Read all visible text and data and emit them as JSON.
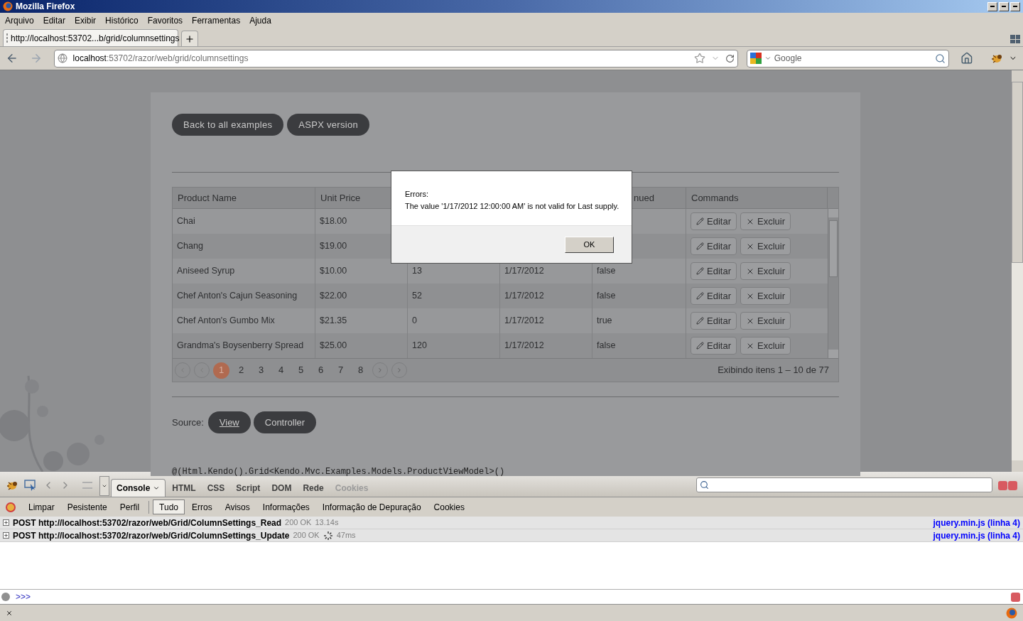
{
  "window": {
    "title": "Mozilla Firefox"
  },
  "menu": [
    "Arquivo",
    "Editar",
    "Exibir",
    "Histórico",
    "Favoritos",
    "Ferramentas",
    "Ajuda"
  ],
  "tabs": [
    {
      "label": "http://localhost:53702...b/grid/columnsettings",
      "selected": true
    }
  ],
  "address": {
    "host": "localhost",
    "path": ":53702/razor/web/grid/columnsettings"
  },
  "search": {
    "placeholder": "Google"
  },
  "page": {
    "top_buttons": [
      "Back to all examples",
      "ASPX version"
    ],
    "grid": {
      "header": {
        "product_name": "Product Name",
        "unit_price": "Unit Price",
        "column_5": "nued",
        "commands": "Commands"
      },
      "rows": [
        {
          "product_name": "Chai",
          "unit_price": "$18.00",
          "commands": [
            "Editar",
            "Excluir"
          ]
        },
        {
          "product_name": "Chang",
          "unit_price": "$19.00",
          "commands": [
            "Editar",
            "Excluir"
          ]
        },
        {
          "product_name": "Aniseed Syrup",
          "unit_price": "$10.00",
          "column_3": "13",
          "column_4": "1/17/2012",
          "column_5": "false",
          "commands": [
            "Editar",
            "Excluir"
          ]
        },
        {
          "product_name": "Chef Anton's Cajun Seasoning",
          "unit_price": "$22.00",
          "column_3": "52",
          "column_4": "1/17/2012",
          "column_5": "false",
          "commands": [
            "Editar",
            "Excluir"
          ]
        },
        {
          "product_name": "Chef Anton's Gumbo Mix",
          "unit_price": "$21.35",
          "column_3": "0",
          "column_4": "1/17/2012",
          "column_5": "true",
          "commands": [
            "Editar",
            "Excluir"
          ]
        },
        {
          "product_name": "Grandma's Boysenberry Spread",
          "unit_price": "$25.00",
          "column_3": "120",
          "column_4": "1/17/2012",
          "column_5": "false",
          "commands": [
            "Editar",
            "Excluir"
          ]
        }
      ],
      "pages": [
        {
          "label": "1",
          "selected": true
        },
        {
          "label": "2",
          "selected": false
        },
        {
          "label": "3",
          "selected": false
        },
        {
          "label": "4",
          "selected": false
        },
        {
          "label": "5",
          "selected": false
        },
        {
          "label": "6",
          "selected": false
        },
        {
          "label": "7",
          "selected": false
        },
        {
          "label": "8",
          "selected": false
        }
      ],
      "pager_info": "Exibindo itens 1 – 10 de 77"
    },
    "source_label": "Source:",
    "source_buttons": [
      {
        "label": "View",
        "selected": true
      },
      {
        "label": "Controller",
        "selected": false
      }
    ],
    "code_line": "@(Html.Kendo().Grid<Kendo.Mvc.Examples.Models.ProductViewModel>()"
  },
  "dialog": {
    "title": "Errors:",
    "message": "The value '1/17/2012 12:00:00 AM' is not valid for Last supply.",
    "button": "OK"
  },
  "firebug": {
    "tabs": [
      {
        "label": "Console",
        "selected": true,
        "disabled": false
      },
      {
        "label": "HTML",
        "selected": false,
        "disabled": false
      },
      {
        "label": "CSS",
        "selected": false,
        "disabled": false
      },
      {
        "label": "Script",
        "selected": false,
        "disabled": false
      },
      {
        "label": "DOM",
        "selected": false,
        "disabled": false
      },
      {
        "label": "Rede",
        "selected": false,
        "disabled": false
      },
      {
        "label": "Cookies",
        "selected": false,
        "disabled": true
      }
    ],
    "actions": [
      "Limpar",
      "Pesistente",
      "Perfil"
    ],
    "filters": [
      {
        "label": "Tudo",
        "selected": true
      },
      {
        "label": "Erros",
        "selected": false
      },
      {
        "label": "Avisos",
        "selected": false
      },
      {
        "label": "Informações",
        "selected": false
      },
      {
        "label": "Informação de Depuração",
        "selected": false
      },
      {
        "label": "Cookies",
        "selected": false
      }
    ],
    "log": [
      {
        "method": "POST",
        "url": "http://localhost:53702/razor/web/Grid/ColumnSettings_Read",
        "status": "200 OK",
        "time": "13.14s",
        "loading": false,
        "source": "jquery.min.js (linha 4)"
      },
      {
        "method": "POST",
        "url": "http://localhost:53702/razor/web/Grid/ColumnSettings_Update",
        "status": "200 OK",
        "time": "47ms",
        "loading": true,
        "source": "jquery.min.js (linha 4)"
      }
    ],
    "prompt": ">>>"
  }
}
